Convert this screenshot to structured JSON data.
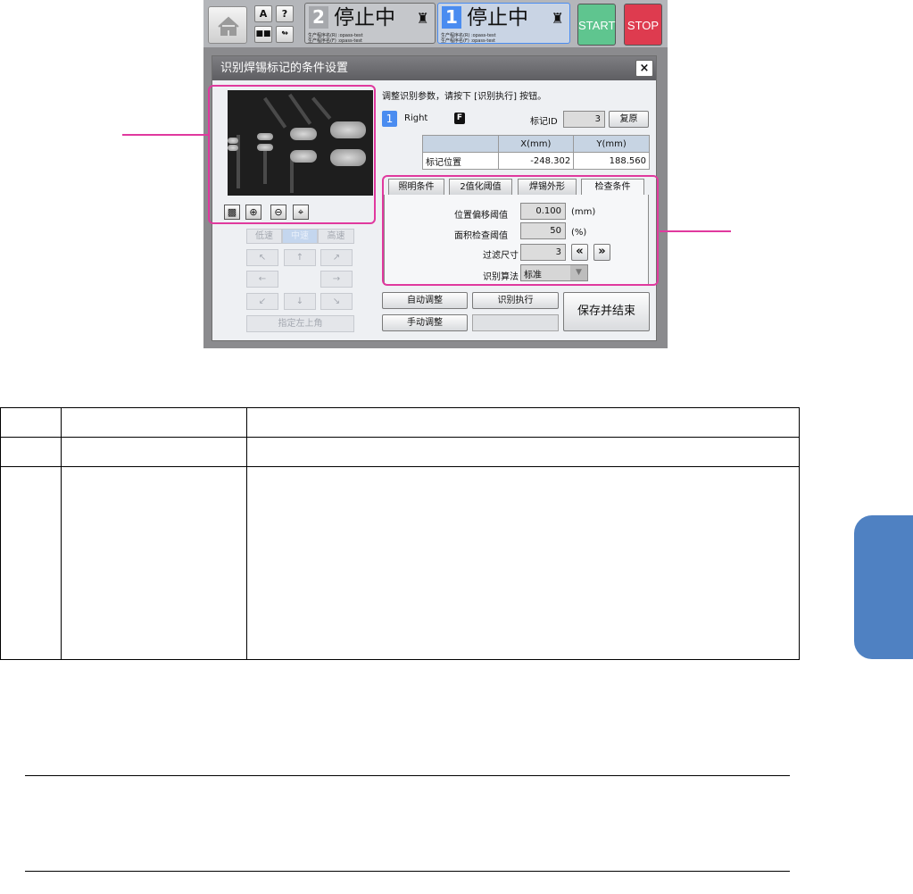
{
  "topbar": {
    "icon_a": "A",
    "icon_help": "?",
    "lane2": {
      "num": "2",
      "status": "停止中",
      "prog_r": "生产程序名(R) :opass-test",
      "prog_f": "生产程序名(F) :opass-test"
    },
    "lane1": {
      "num": "1",
      "status": "停止中",
      "prog_r": "生产程序名(R) :opass-test",
      "prog_f": "生产程序名(F) :opass-test"
    },
    "start": "START",
    "stop": "STOP",
    "colors": {
      "start": "#5fc58f",
      "stop": "#de3b4f",
      "lane_active": "#4a8cf0"
    }
  },
  "dialog": {
    "title": "识别焊锡标记的条件设置",
    "close": "×",
    "instruction": "调整识别参数，请按下 [识别执行] 按钮。",
    "lane_num": "1",
    "side": "Right",
    "f_badge": "F",
    "mark_id_label": "标记ID",
    "mark_id_value": "3",
    "restore": "复原",
    "pos_table": {
      "col_x": "X(mm)",
      "col_y": "Y(mm)",
      "row_label": "标记位置",
      "x": "-248.302",
      "y": "188.560"
    },
    "speeds": [
      "低速",
      "中速",
      "高速"
    ],
    "arrows": [
      "↖",
      "↑",
      "↗",
      "←",
      "→",
      "↙",
      "↓",
      "↘"
    ],
    "set_top_left": "指定左上角",
    "tabs": [
      "照明条件",
      "2值化阈值",
      "焊锡外形",
      "检查条件"
    ],
    "params": {
      "offset_label": "位置偏移阈值",
      "offset_value": "0.100",
      "offset_unit": "(mm)",
      "area_label": "面积检查阈值",
      "area_value": "50",
      "area_unit": "(%)",
      "filter_label": "过滤尺寸",
      "filter_value": "3",
      "algo_label": "识别算法",
      "algo_value": "标准"
    },
    "auto_adjust": "自动调整",
    "manual_adjust": "手动调整",
    "execute": "识别执行",
    "save_exit": "保存并结束"
  }
}
